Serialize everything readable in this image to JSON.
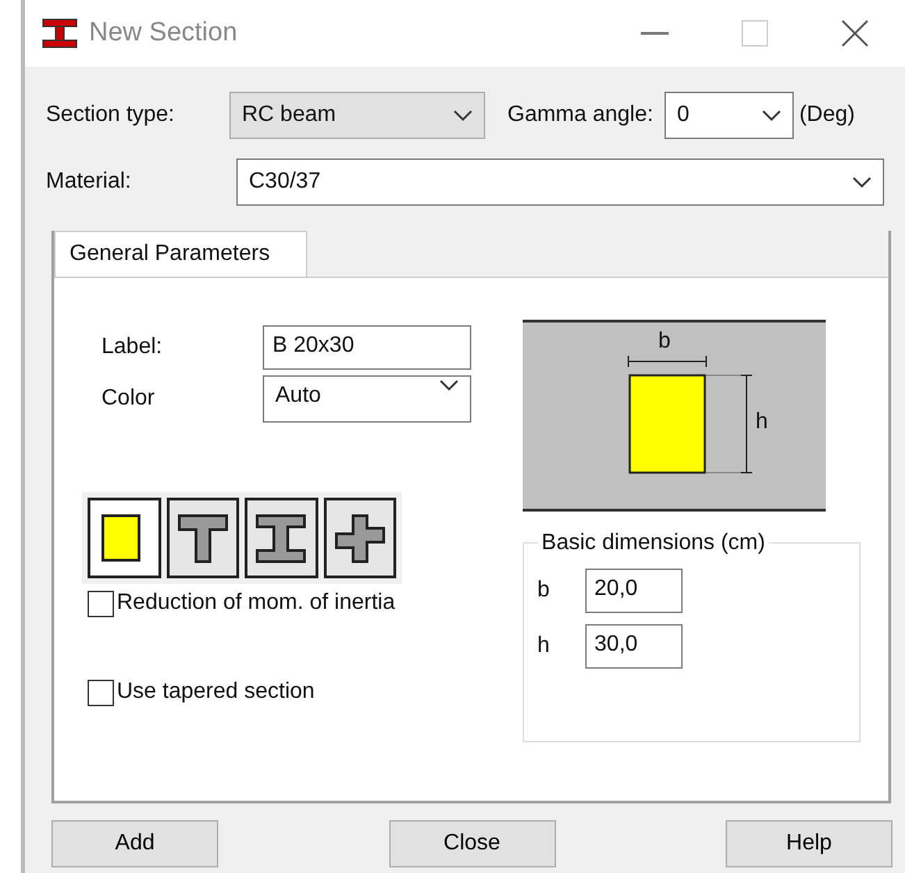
{
  "window": {
    "title": "New Section"
  },
  "section_type": {
    "label": "Section type:",
    "value": "RC beam"
  },
  "gamma_angle": {
    "label": "Gamma angle:",
    "value": "0",
    "unit": "(Deg)"
  },
  "material": {
    "label": "Material:",
    "value": "C30/37"
  },
  "tabs": [
    {
      "label": "General Parameters",
      "selected": true
    }
  ],
  "label_field": {
    "label": "Label:",
    "value": "B 20x30"
  },
  "color_field": {
    "label": "Color",
    "value": "Auto"
  },
  "preview": {
    "dim_b": "b",
    "dim_h": "h"
  },
  "shapes": [
    {
      "kind": "rect",
      "selected": true
    },
    {
      "kind": "tee",
      "selected": false
    },
    {
      "kind": "ibeam",
      "selected": false
    },
    {
      "kind": "cross",
      "selected": false
    }
  ],
  "options": [
    {
      "label": "Reduction of mom. of inertia",
      "checked": false
    },
    {
      "label": "Use tapered section",
      "checked": false
    }
  ],
  "dimensions": {
    "title": "Basic dimensions (cm)",
    "fields": [
      {
        "label": "b",
        "value": "20,0"
      },
      {
        "label": "h",
        "value": "30,0"
      }
    ]
  },
  "buttons": [
    "Add",
    "Close",
    "Help"
  ]
}
